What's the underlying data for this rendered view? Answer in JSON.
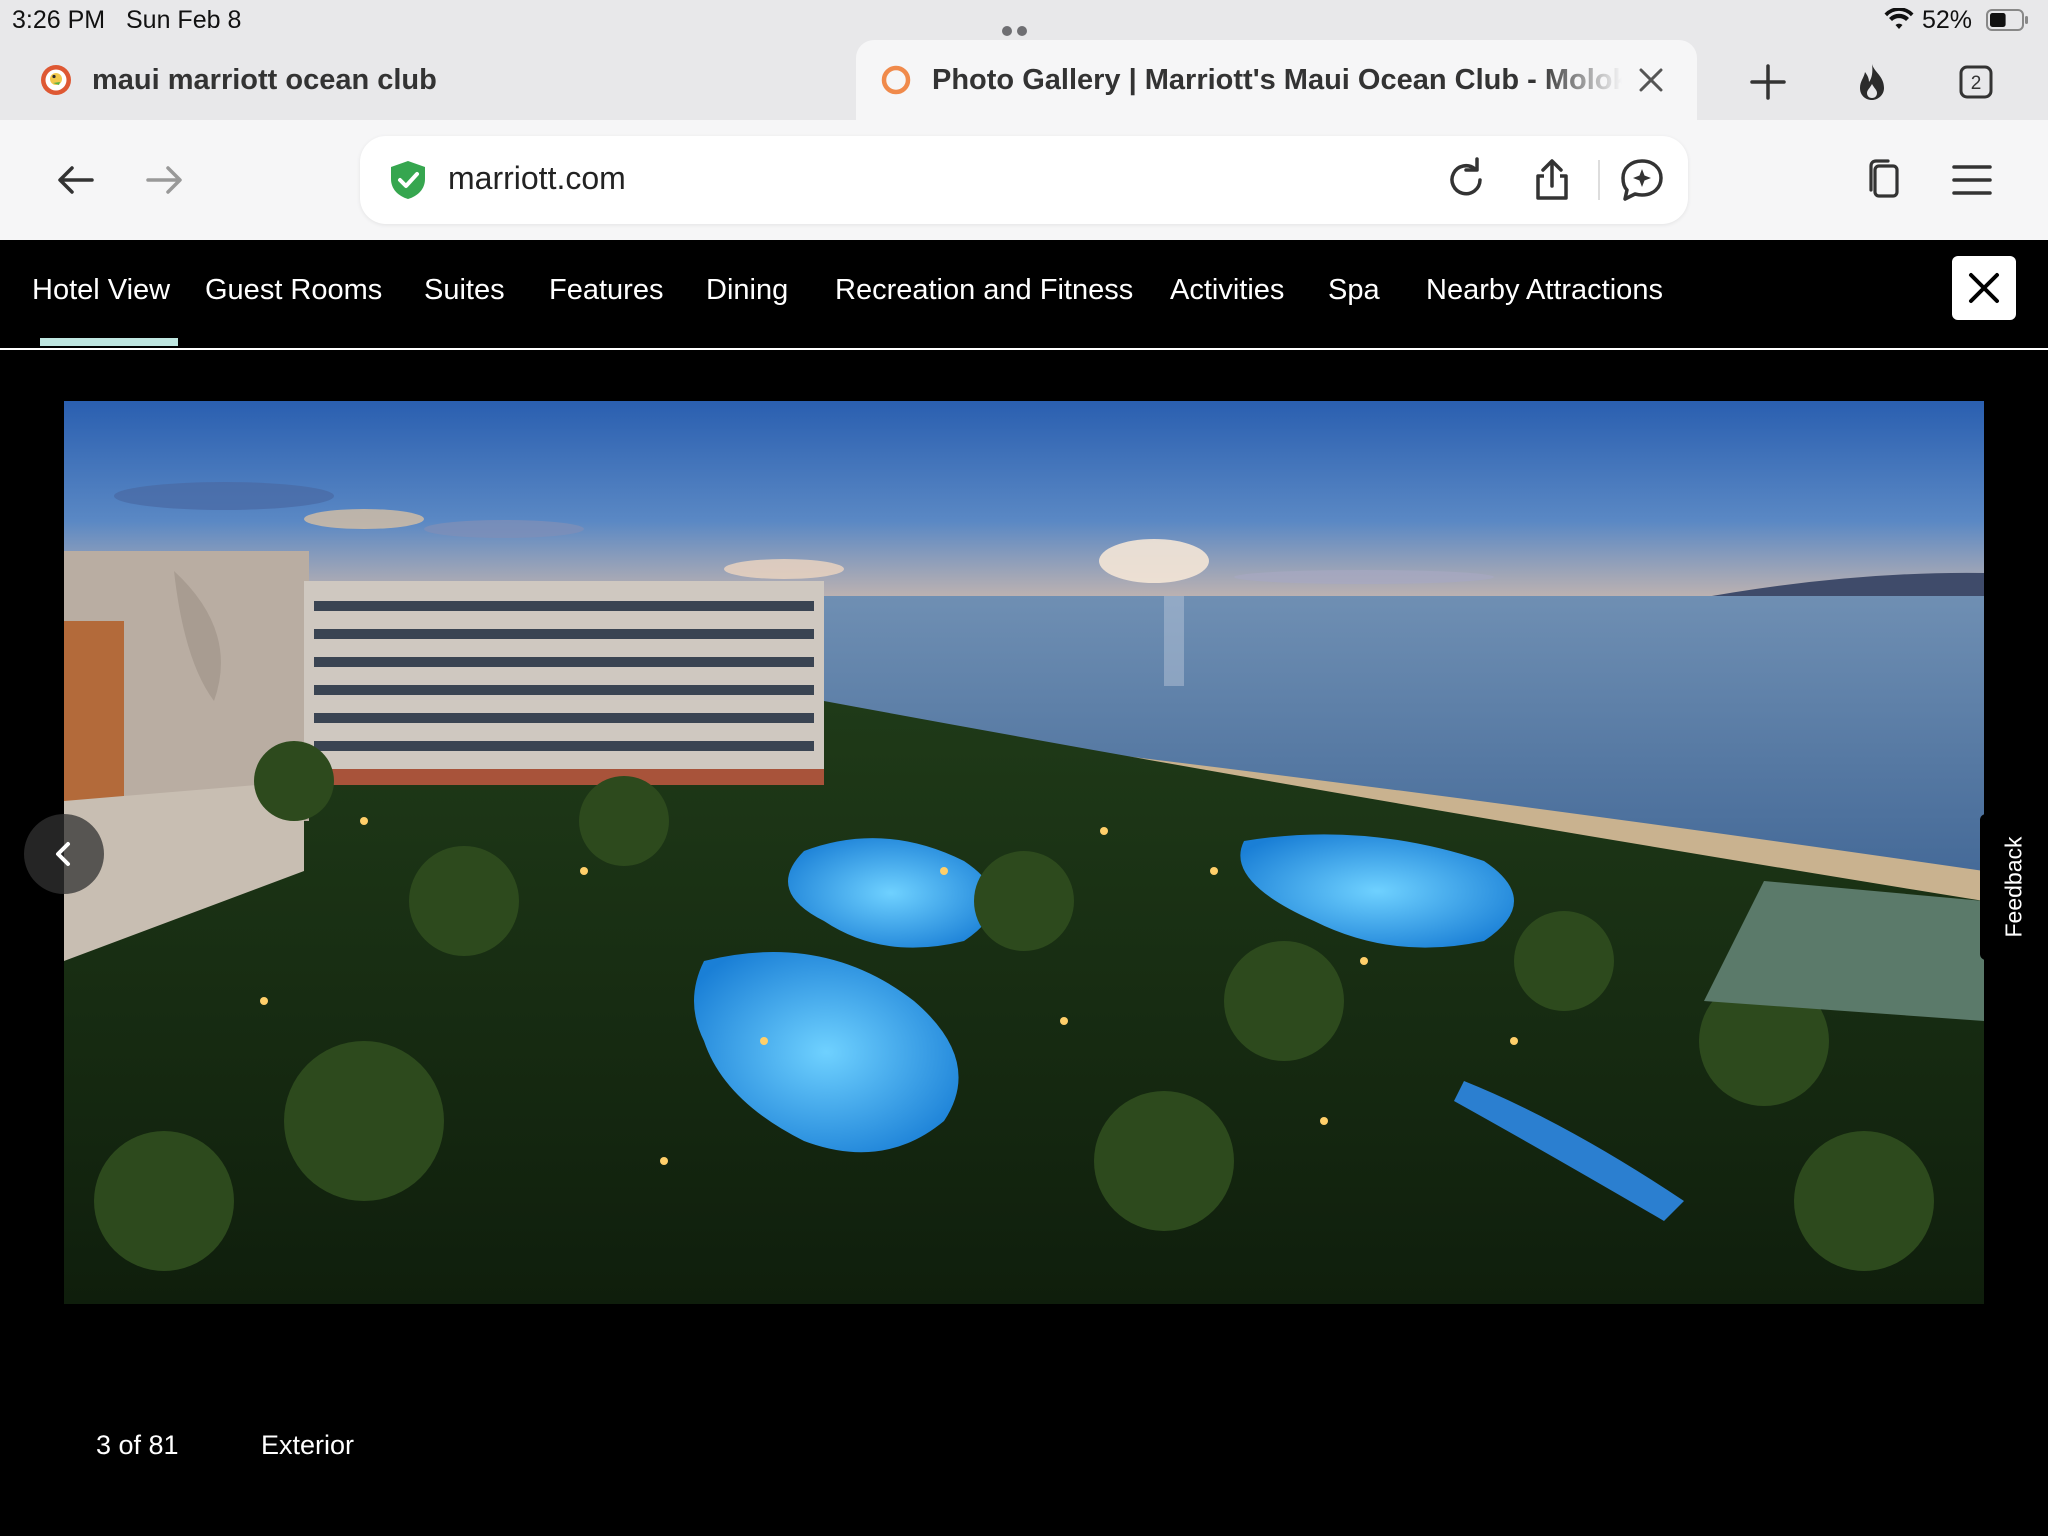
{
  "status_bar": {
    "time": "3:26 PM",
    "date": "Sun Feb 8",
    "battery": "52%",
    "battery_level": 0.52,
    "icons": [
      "multitask-dots-icon",
      "wifi-icon",
      "battery-icon"
    ]
  },
  "tabs": [
    {
      "title": "maui marriott ocean club",
      "favicon": "duckduckgo-icon",
      "active": false
    },
    {
      "title": "Photo Gallery | Marriott's Maui Ocean Club - Molokai, Maui & Lanai Towers",
      "favicon": "marriott-favicon-icon",
      "active": true
    }
  ],
  "tab_toolbar": {
    "icons": [
      "new-tab-icon",
      "fire-icon",
      "tab-count-icon"
    ],
    "tab_count": "2"
  },
  "address_bar": {
    "url": "marriott.com",
    "icons": [
      "back-icon",
      "forward-icon",
      "shield-icon",
      "reload-icon",
      "share-icon",
      "ai-chat-icon",
      "copy-icon",
      "menu-icon"
    ]
  },
  "gallery_nav": {
    "items": [
      {
        "label": "Hotel View",
        "active": true
      },
      {
        "label": "Guest Rooms",
        "active": false
      },
      {
        "label": "Suites",
        "active": false
      },
      {
        "label": "Features",
        "active": false
      },
      {
        "label": "Dining",
        "active": false
      },
      {
        "label": "Recreation and Fitness",
        "active": false
      },
      {
        "label": "Activities",
        "active": false
      },
      {
        "label": "Spa",
        "active": false
      },
      {
        "label": "Nearby Attractions",
        "active": false
      }
    ],
    "close_icon": "close-icon",
    "active_color": "#bfe6e0"
  },
  "gallery": {
    "counter": "3 of 81",
    "category": "Exterior",
    "prev_icon": "chevron-left-icon",
    "feedback_label": "Feedback"
  }
}
